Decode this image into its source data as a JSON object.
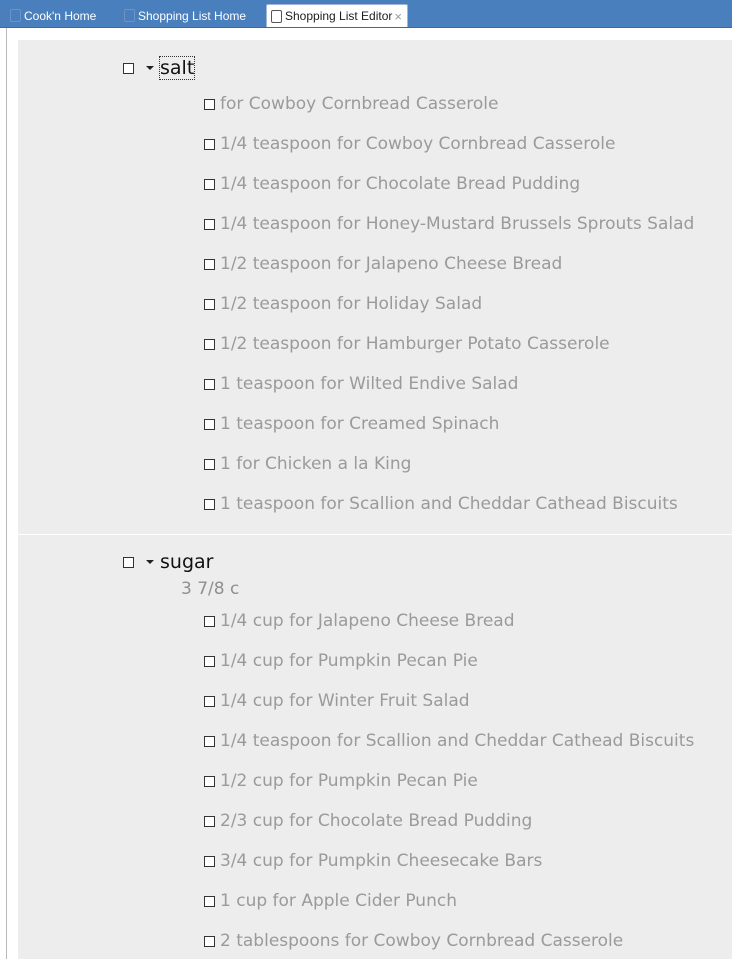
{
  "tabs": [
    {
      "label": "Cook'n Home"
    },
    {
      "label": "Shopping List Home"
    },
    {
      "label": "Shopping List Editor",
      "close": "×"
    }
  ],
  "groups": [
    {
      "name": "salt",
      "amount": "",
      "items": [
        "for Cowboy Cornbread Casserole",
        "1/4 teaspoon for Cowboy Cornbread Casserole",
        "1/4 teaspoon for Chocolate Bread Pudding",
        "1/4 teaspoon for Honey-Mustard Brussels Sprouts Salad",
        "1/2 teaspoon for Jalapeno Cheese Bread",
        "1/2 teaspoon for Holiday Salad",
        "1/2 teaspoon for Hamburger Potato Casserole",
        "1 teaspoon for Wilted Endive Salad",
        "1 teaspoon for Creamed Spinach",
        "1 for Chicken a la King",
        "1 teaspoon for Scallion and Cheddar Cathead Biscuits"
      ]
    },
    {
      "name": "sugar",
      "amount": "3 7/8 c",
      "items": [
        "1/4 cup for Jalapeno Cheese Bread",
        "1/4 cup for Pumpkin Pecan Pie",
        "1/4 cup for Winter Fruit Salad",
        "1/4 teaspoon for Scallion and Cheddar Cathead Biscuits",
        "1/2 cup for Pumpkin Pecan Pie",
        "2/3 cup for Chocolate Bread Pudding",
        "3/4 cup for Pumpkin Cheesecake Bars",
        "1 cup for Apple Cider Punch",
        "2 tablespoons for Cowboy Cornbread Casserole"
      ]
    }
  ]
}
